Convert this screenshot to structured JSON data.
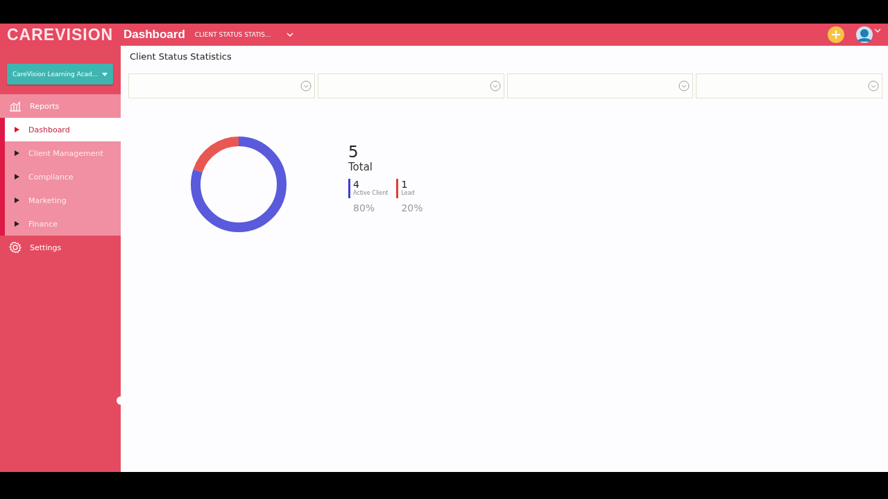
{
  "header": {
    "logo": "CAREVISION",
    "title": "Dashboard",
    "breadcrumb": "CLIENT STATUS STATIS..."
  },
  "sidebar": {
    "organization": "CareVision Learning Acad...",
    "items": [
      {
        "label": "Reports",
        "kind": "section",
        "expanded": true,
        "children": [
          {
            "label": "Dashboard",
            "selected": true
          },
          {
            "label": "Client Management",
            "selected": false
          },
          {
            "label": "Compliance",
            "selected": false
          },
          {
            "label": "Marketing",
            "selected": false
          },
          {
            "label": "Finance",
            "selected": false
          }
        ]
      },
      {
        "label": "Settings",
        "kind": "settings"
      }
    ]
  },
  "page": {
    "title": "Client Status Statistics",
    "filters": [
      {
        "kind": "dropdown"
      },
      {
        "kind": "dropdown"
      },
      {
        "kind": "dropdown"
      },
      {
        "kind": "dropdown"
      }
    ],
    "summary": {
      "total": "5",
      "total_label": "Total",
      "stats": [
        {
          "count": "4",
          "label": "Active Client",
          "percent": "80%",
          "color": "#3d3dd6"
        },
        {
          "count": "1",
          "label": "Lead",
          "percent": "20%",
          "color": "#e53935"
        }
      ]
    }
  }
}
